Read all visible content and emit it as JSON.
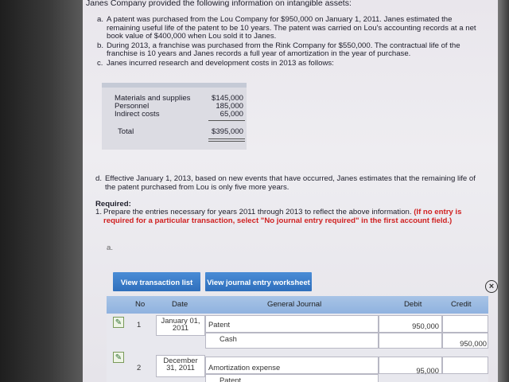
{
  "intro": "Janes Company provided the following information on intangible assets:",
  "items": [
    {
      "letter": "a.",
      "text": "A patent was purchased from the Lou Company for $950,000 on January 1, 2011. Janes estimated the remaining useful life of the patent to be 10 years. The patent was carried on Lou's accounting records at a net book value of $400,000 when Lou sold it to Janes."
    },
    {
      "letter": "b.",
      "text": "During 2013, a franchise was purchased from the Rink Company for $550,000. The contractual life of the franchise is 10 years and Janes records a full year of amortization in the year of purchase."
    },
    {
      "letter": "c.",
      "text": "Janes incurred research and development costs in 2013 as follows:"
    }
  ],
  "costs": {
    "rows": [
      {
        "label": "Materials and supplies",
        "value": "$145,000"
      },
      {
        "label": "Personnel",
        "value": "185,000"
      },
      {
        "label": "Indirect costs",
        "value": "65,000"
      }
    ],
    "total_label": "Total",
    "total_value": "$395,000"
  },
  "item_d": {
    "letter": "d.",
    "text": "Effective January 1, 2013, based on new events that have occurred, Janes estimates that the remaining life of the patent purchased from Lou is only five more years."
  },
  "required": {
    "heading": "Required:",
    "number": "1.",
    "text": "Prepare the entries necessary for years 2011 through 2013 to reflect the above information.",
    "note": "(If no entry is required for a particular transaction, select \"No journal entry required\" in the first account field.)"
  },
  "part_label": "a.",
  "buttons": {
    "transaction_list": "View transaction list",
    "journal_worksheet": "View journal entry worksheet"
  },
  "journal": {
    "headers": {
      "no": "No",
      "date": "Date",
      "general_journal": "General Journal",
      "debit": "Debit",
      "credit": "Credit"
    },
    "entries": [
      {
        "no": "1",
        "date": "January 01, 2011",
        "lines": [
          {
            "account": "Patent",
            "debit": "950,000",
            "credit": ""
          },
          {
            "account": "Cash",
            "debit": "",
            "credit": "950,000"
          }
        ]
      },
      {
        "no": "2",
        "date": "December 31, 2011",
        "lines": [
          {
            "account": "Amortization expense",
            "debit": "95,000",
            "credit": ""
          },
          {
            "account": "Patent",
            "debit": "",
            "credit": ""
          }
        ]
      }
    ]
  },
  "colors": {
    "button": "#3a7cc8",
    "header": "#9bbbe3",
    "note": "#d02020"
  }
}
